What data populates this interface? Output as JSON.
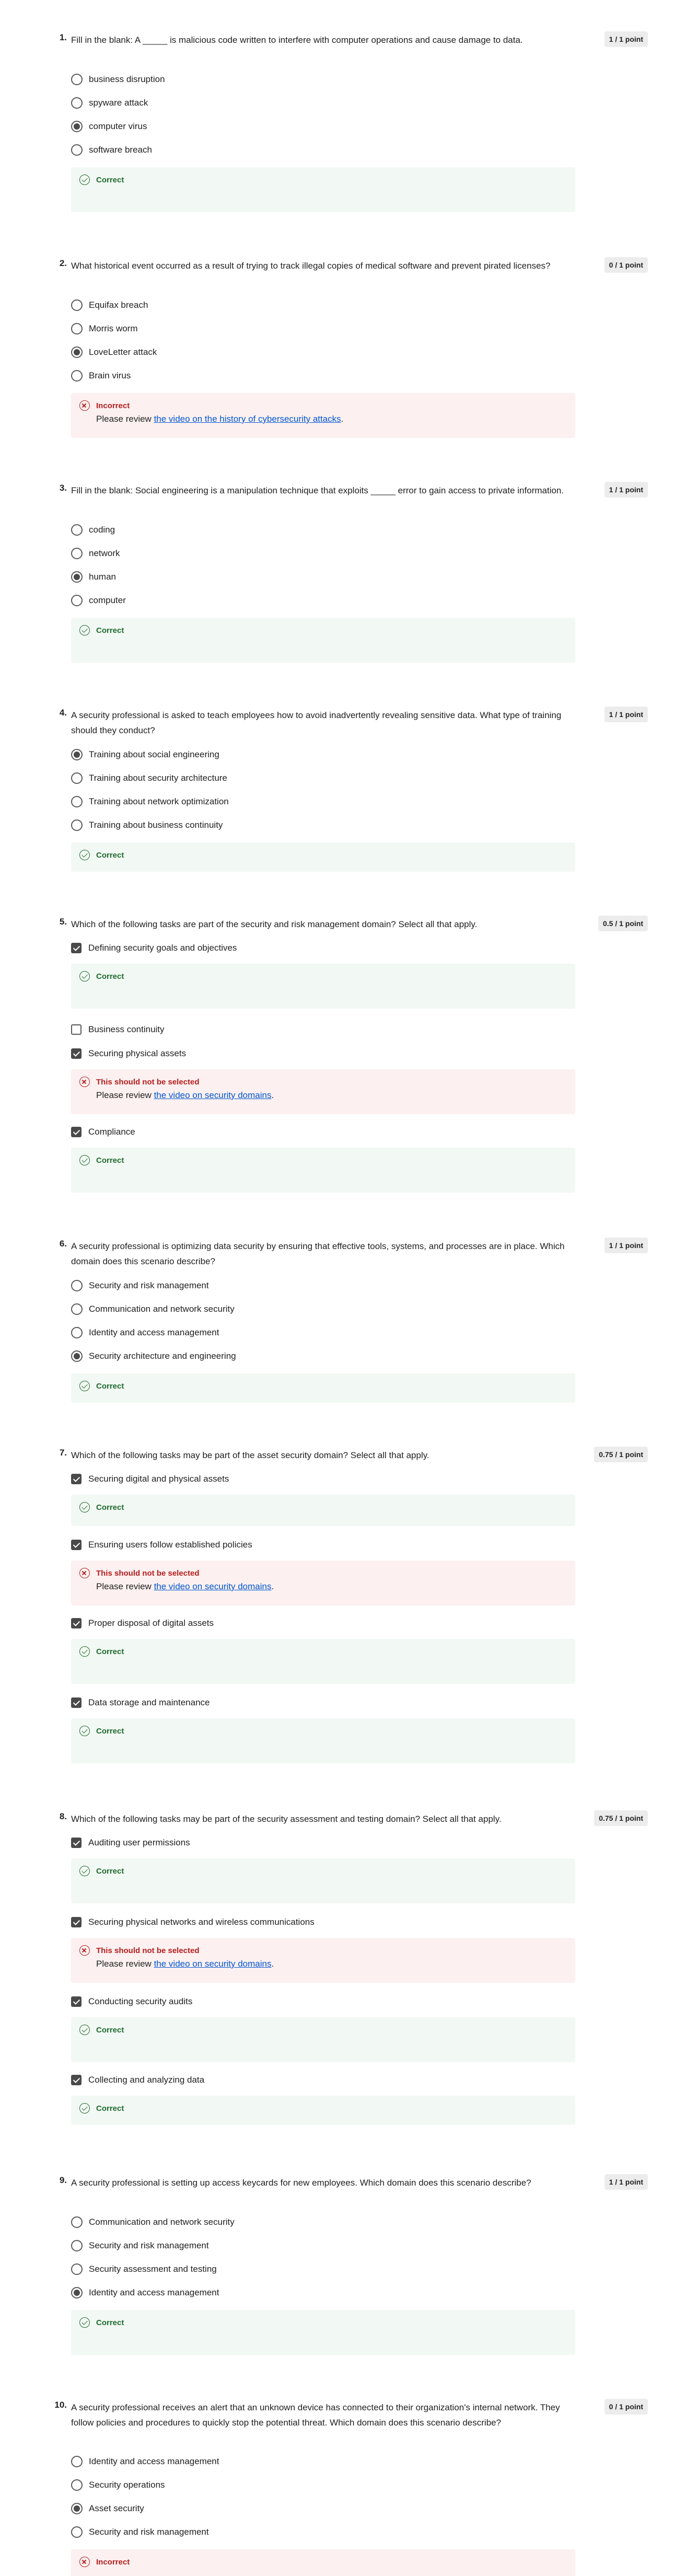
{
  "quiz": {
    "questions": [
      {
        "number": "1.",
        "text": "Fill in the blank: A _____ is malicious code written to interfere with computer operations and cause damage to data.",
        "score": "1 / 1 point",
        "options": [
          {
            "label": "business disruption",
            "selected": false
          },
          {
            "label": "spyware attack",
            "selected": false
          },
          {
            "label": "computer virus",
            "selected": true
          },
          {
            "label": "software breach",
            "selected": false
          }
        ],
        "feedback": {
          "status": "Correct"
        }
      },
      {
        "number": "2.",
        "text": "What historical event occurred as a result of trying to track illegal copies of medical software and prevent pirated licenses?",
        "score": "0 / 1 point",
        "options": [
          {
            "label": "Equifax breach",
            "selected": false
          },
          {
            "label": "Morris worm",
            "selected": false
          },
          {
            "label": "LoveLetter attack",
            "selected": true
          },
          {
            "label": "Brain virus",
            "selected": false
          }
        ],
        "feedback": {
          "status": "Incorrect",
          "review_prefix": "Please review ",
          "review_link": "the video on the history of cybersecurity attacks",
          "review_suffix": "."
        }
      },
      {
        "number": "3.",
        "text": "Fill in the blank: Social engineering is a manipulation technique that exploits _____ error to gain access to private information.",
        "score": "1 / 1 point",
        "options": [
          {
            "label": "coding",
            "selected": false
          },
          {
            "label": "network",
            "selected": false
          },
          {
            "label": "human",
            "selected": true
          },
          {
            "label": "computer",
            "selected": false
          }
        ],
        "feedback": {
          "status": "Correct"
        }
      },
      {
        "number": "4.",
        "text": "A security professional is asked to teach employees how to avoid inadvertently revealing sensitive data. What type of training should they conduct?",
        "score": "1 / 1 point",
        "options": [
          {
            "label": "Training about social engineering",
            "selected": true
          },
          {
            "label": "Training about security architecture",
            "selected": false
          },
          {
            "label": "Training about network optimization",
            "selected": false
          },
          {
            "label": "Training about business continuity",
            "selected": false
          }
        ],
        "feedback": {
          "status": "Correct"
        }
      },
      {
        "number": "5.",
        "text": "Which of the following tasks are part of the security and risk management domain? Select all that apply.",
        "score": "0.5 / 1 point",
        "options": [
          {
            "label": "Defining security goals and objectives",
            "selected": true,
            "feedback": {
              "status": "Correct"
            }
          },
          {
            "label": "Business continuity",
            "selected": false
          },
          {
            "label": "Securing physical assets",
            "selected": true,
            "feedback": {
              "status": "This should not be selected",
              "review_prefix": "Please review ",
              "review_link": "the video on security domains",
              "review_suffix": "."
            }
          },
          {
            "label": "Compliance",
            "selected": true,
            "feedback": {
              "status": "Correct"
            }
          }
        ]
      },
      {
        "number": "6.",
        "text": "A security professional is optimizing data security by ensuring that effective tools, systems, and processes are in place. Which domain does this scenario describe?",
        "score": "1 / 1 point",
        "options": [
          {
            "label": "Security and risk management",
            "selected": false
          },
          {
            "label": "Communication and network security",
            "selected": false
          },
          {
            "label": "Identity and access management",
            "selected": false
          },
          {
            "label": "Security architecture and engineering",
            "selected": true
          }
        ],
        "feedback": {
          "status": "Correct"
        }
      },
      {
        "number": "7.",
        "text": "Which of the following tasks may be part of the asset security domain? Select all that apply.",
        "score": "0.75 / 1 point",
        "options": [
          {
            "label": "Securing digital and physical assets",
            "selected": true,
            "feedback": {
              "status": "Correct"
            }
          },
          {
            "label": "Ensuring users follow established policies",
            "selected": true,
            "feedback": {
              "status": "This should not be selected",
              "review_prefix": "Please review ",
              "review_link": "the video on security domains",
              "review_suffix": "."
            }
          },
          {
            "label": "Proper disposal of digital assets",
            "selected": true,
            "feedback": {
              "status": "Correct"
            }
          },
          {
            "label": "Data storage and maintenance",
            "selected": true,
            "feedback": {
              "status": "Correct"
            }
          }
        ]
      },
      {
        "number": "8.",
        "text": "Which of the following tasks may be part of the security assessment and testing domain? Select all that apply.",
        "score": "0.75 / 1 point",
        "options": [
          {
            "label": "Auditing user permissions",
            "selected": true,
            "feedback": {
              "status": "Correct"
            }
          },
          {
            "label": "Securing physical networks and wireless communications",
            "selected": true,
            "feedback": {
              "status": "This should not be selected",
              "review_prefix": "Please review ",
              "review_link": "the video on security domains",
              "review_suffix": "."
            }
          },
          {
            "label": "Conducting security audits",
            "selected": true,
            "feedback": {
              "status": "Correct"
            }
          },
          {
            "label": "Collecting and analyzing data",
            "selected": true,
            "feedback": {
              "status": "Correct"
            }
          }
        ]
      },
      {
        "number": "9.",
        "text": "A security professional is setting up access keycards for new employees. Which domain does this scenario describe?",
        "score": "1 / 1 point",
        "options": [
          {
            "label": "Communication and network security",
            "selected": false
          },
          {
            "label": "Security and risk management",
            "selected": false
          },
          {
            "label": "Security assessment and testing",
            "selected": false
          },
          {
            "label": "Identity and access management",
            "selected": true
          }
        ],
        "feedback": {
          "status": "Correct"
        }
      },
      {
        "number": "10.",
        "text": "A security professional receives an alert that an unknown device has connected to their organization's internal network. They follow policies and procedures to quickly stop the potential threat. Which domain does this scenario describe?",
        "score": "0 / 1 point",
        "options": [
          {
            "label": "Identity and access management",
            "selected": false
          },
          {
            "label": "Security operations",
            "selected": false
          },
          {
            "label": "Asset security",
            "selected": true
          },
          {
            "label": "Security and risk management",
            "selected": false
          }
        ],
        "feedback": {
          "status": "Incorrect"
        }
      }
    ]
  }
}
